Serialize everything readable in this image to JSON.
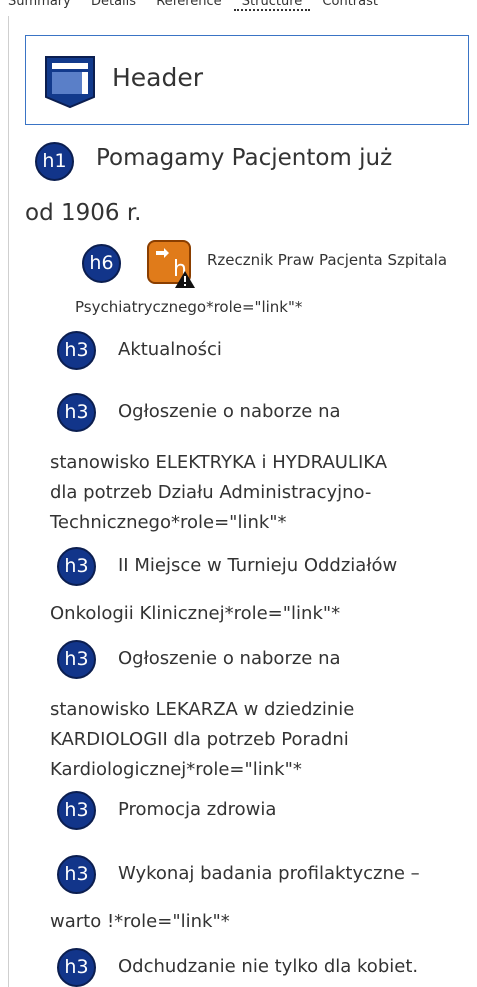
{
  "tabs": [
    "Summary",
    "Details",
    "Reference",
    "Structure",
    "Contrast"
  ],
  "header_landmark": {
    "label": "Header"
  },
  "h1": {
    "badge": "h1",
    "line1": "Pomagamy Pacjentom już",
    "line2": "od 1906 r."
  },
  "h6": {
    "badge": "h6",
    "icon_badge": "h",
    "line1": "Rzecznik Praw Pacjenta Szpitala",
    "line2": "Psychiatrycznego*role=\"link\"*"
  },
  "headings": [
    {
      "badge": "h3",
      "lines": [
        "Aktualności"
      ]
    },
    {
      "badge": "h3",
      "lines": [
        "Ogłoszenie o naborze na",
        "stanowisko ELEKTRYKA i HYDRAULIKA",
        "dla potrzeb Działu Administracyjno-",
        "Technicznego*role=\"link\"*"
      ]
    },
    {
      "badge": "h3",
      "lines": [
        "II Miejsce w Turnieju Oddziałów",
        "Onkologii Klinicznej*role=\"link\"*"
      ]
    },
    {
      "badge": "h3",
      "lines": [
        "Ogłoszenie o naborze na",
        "stanowisko LEKARZA w dziedzinie",
        "KARDIOLOGII dla potrzeb Poradni",
        "Kardiologicznej*role=\"link\"*"
      ]
    },
    {
      "badge": "h3",
      "lines": [
        "Promocja zdrowia"
      ]
    },
    {
      "badge": "h3",
      "lines": [
        "Wykonaj badania profilaktyczne –",
        "warto !*role=\"link\"*"
      ]
    },
    {
      "badge": "h3",
      "lines": [
        "Odchudzanie nie tylko dla kobiet."
      ]
    }
  ],
  "colors": {
    "badge": "#12358a",
    "landmark_border": "#3a74c5",
    "warning_icon": "#e07b1a"
  }
}
